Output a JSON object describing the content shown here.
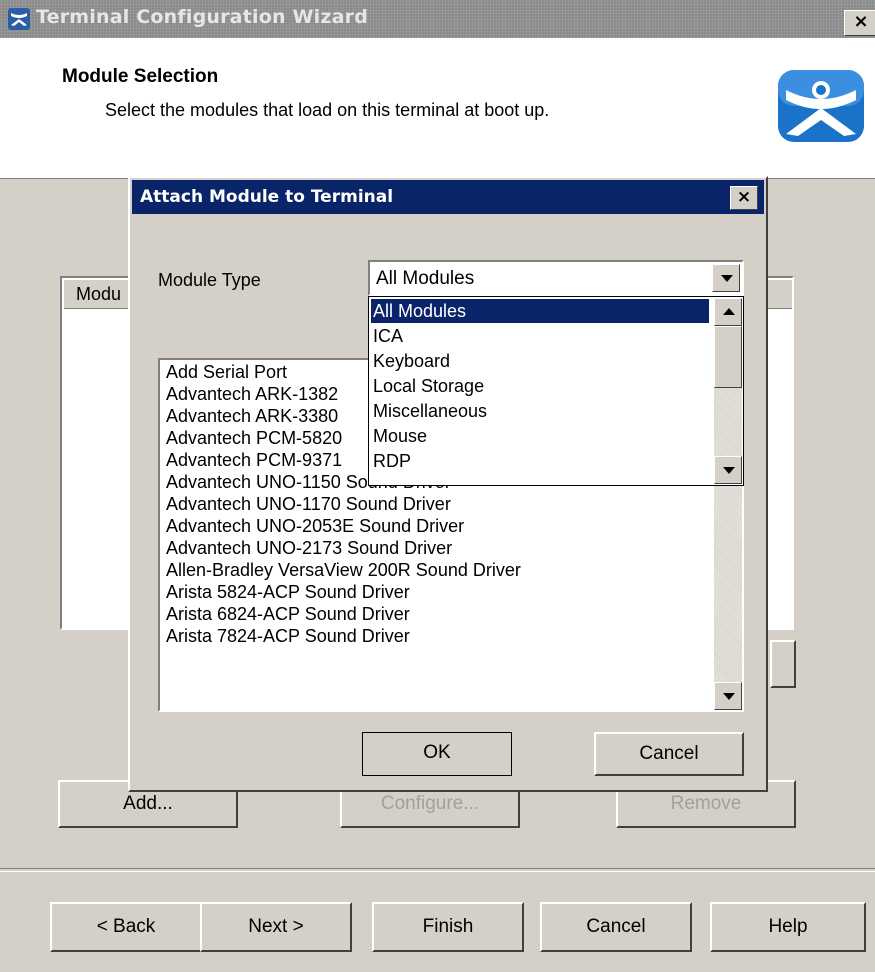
{
  "window": {
    "title": "Terminal Configuration Wizard",
    "close_label": "×"
  },
  "header": {
    "title": "Module Selection",
    "subtitle": "Select the modules that load on this terminal at boot up."
  },
  "main": {
    "module_column_header": "Modu",
    "buttons": {
      "add": "Add...",
      "configure": "Configure...",
      "remove": "Remove"
    }
  },
  "dialog": {
    "title": "Attach Module to Terminal",
    "close_label": "×",
    "module_type_label": "Module Type",
    "module_type_selected": "All Modules",
    "dropdown_options": [
      "All Modules",
      "ICA",
      "Keyboard",
      "Local Storage",
      "Miscellaneous",
      "Mouse",
      "RDP"
    ],
    "modules": [
      "Add Serial Port",
      "Advantech ARK-1382",
      "Advantech ARK-3380",
      "Advantech PCM-5820",
      "Advantech PCM-9371",
      "Advantech UNO-1150 Sound Driver",
      "Advantech UNO-1170 Sound Driver",
      "Advantech UNO-2053E Sound Driver",
      "Advantech UNO-2173 Sound Driver",
      "Allen-Bradley VersaView 200R Sound Driver",
      "Arista 5824-ACP Sound Driver",
      "Arista 6824-ACP Sound Driver",
      "Arista 7824-ACP Sound Driver"
    ],
    "ok_label": "OK",
    "cancel_label": "Cancel"
  },
  "footer": {
    "back_label": "< Back",
    "next_label": "Next >",
    "finish_label": "Finish",
    "cancel_label": "Cancel",
    "help_label": "Help"
  },
  "colors": {
    "dialog_title_bg": "#0a246a",
    "face": "#d4d0c8",
    "logo_blue": "#1a73c8"
  }
}
